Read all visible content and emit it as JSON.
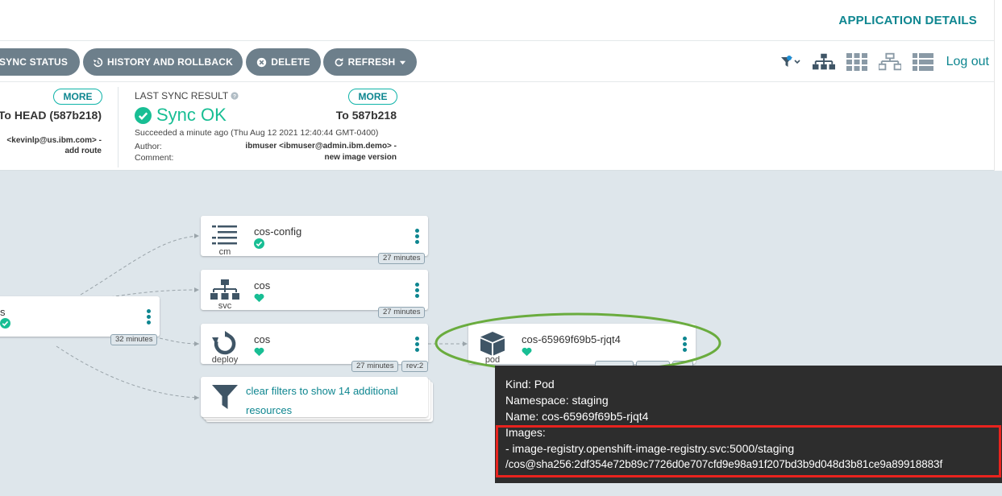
{
  "header": {
    "title": "APPLICATION DETAILS"
  },
  "toolbar": {
    "sync_status": "SYNC STATUS",
    "history": "HISTORY AND ROLLBACK",
    "delete": "DELETE",
    "refresh": "REFRESH",
    "logout": "Log out",
    "icons": [
      "filter-icon",
      "tree-view-icon",
      "pods-grid-icon",
      "network-view-icon",
      "list-view-icon"
    ]
  },
  "sync_status": {
    "more": "MORE",
    "revision": "To HEAD (587b218)",
    "author_line": "<kevinlp@us.ibm.com> -",
    "comment_line": "add route"
  },
  "last_sync": {
    "label": "LAST SYNC RESULT",
    "more": "MORE",
    "status": "Sync OK",
    "revision": "To 587b218",
    "succeeded": "Succeeded a minute ago (Thu Aug 12 2021 12:40:44 GMT-0400)",
    "author_label": "Author:",
    "author_value": "ibmuser <ibmuser@admin.ibm.demo> -",
    "comment_label": "Comment:",
    "comment_value": "new image version"
  },
  "nodes": {
    "app": {
      "name": "s",
      "age": "32 minutes"
    },
    "cm": {
      "kind": "cm",
      "name": "cos-config",
      "age": "27 minutes"
    },
    "svc": {
      "kind": "svc",
      "name": "cos",
      "age": "27 minutes"
    },
    "deploy": {
      "kind": "deploy",
      "name": "cos",
      "age": "27 minutes",
      "rev": "rev:2"
    },
    "filter": {
      "text_1": "clear filters to show 14 additional",
      "text_2": "resources"
    },
    "pod": {
      "kind": "pod",
      "name": "cos-65969f69b5-rjqt4"
    }
  },
  "tooltip": {
    "kind": "Kind: Pod",
    "namespace": "Namespace: staging",
    "name": "Name: cos-65969f69b5-rjqt4",
    "images_label": "Images:",
    "image_line_1": "- image-registry.openshift-image-registry.svc:5000/staging",
    "image_line_2": "/cos@sha256:2df354e72b89c7726d0e707cfd9e98a91f207bd3b9d048d3b81ce9a89918883f"
  },
  "colors": {
    "accent": "#0e8690",
    "healthy": "#18be94",
    "button": "#6d7f8b",
    "highlight_ellipse": "#6aac3e",
    "highlight_box": "#e8231e"
  }
}
